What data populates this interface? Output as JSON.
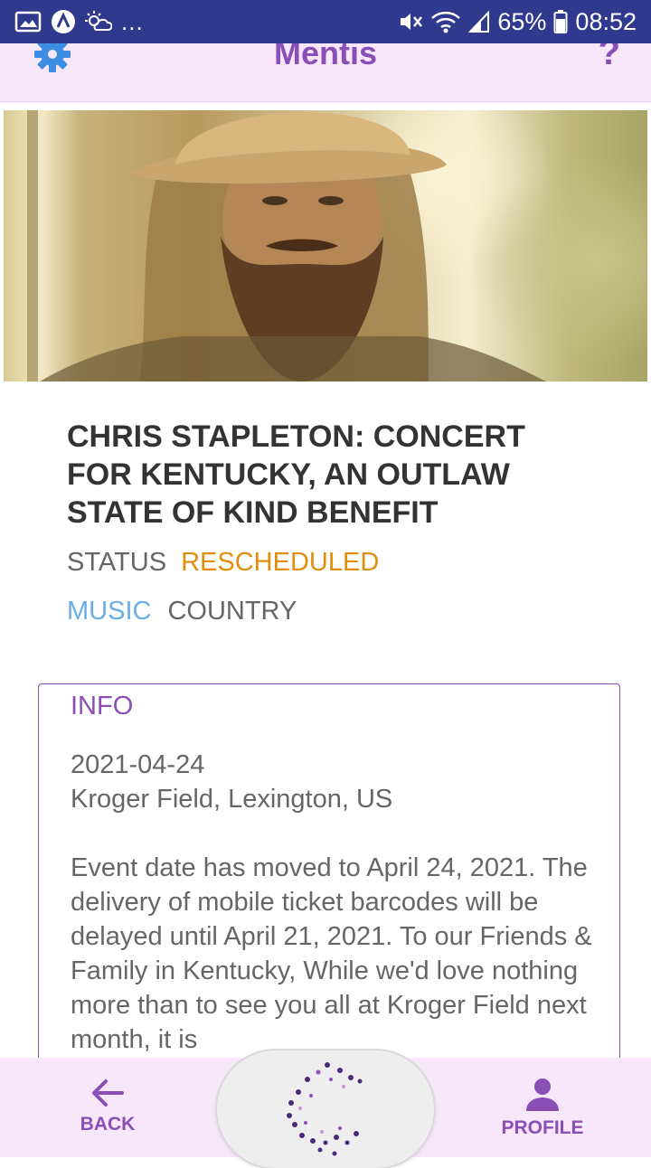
{
  "status_bar": {
    "battery": "65%",
    "time": "08:52",
    "left_icons": [
      "gallery-icon",
      "app-icon",
      "cloud-icon"
    ],
    "overflow": "..."
  },
  "app": {
    "title": "Mentis",
    "settings_icon": "gear-icon",
    "help_label": "?"
  },
  "event": {
    "title": "CHRIS STAPLETON: CONCERT FOR KENTUCKY, AN OUTLAW STATE OF KIND BENEFIT",
    "status_label": "STATUS",
    "status_value": "RESCHEDULED",
    "genre": "MUSIC",
    "subgenre": "COUNTRY"
  },
  "info": {
    "heading": "INFO",
    "date": "2021-04-24",
    "venue": "Kroger Field, Lexington, US",
    "description": "Event date has moved to April 24, 2021. The delivery of mobile ticket barcodes will be delayed until April 21, 2021. To our Friends & Family in Kentucky, While we'd love nothing more than to see you all at Kroger Field next month, it is"
  },
  "nav": {
    "back_label": "BACK",
    "profile_label": "PROFILE"
  },
  "colors": {
    "accent": "#8a4fb6",
    "status_rescheduled": "#e08e0b",
    "genre": "#6aaee8",
    "status_bar": "#2f3a8f",
    "header_bg": "#f8e6fb"
  }
}
